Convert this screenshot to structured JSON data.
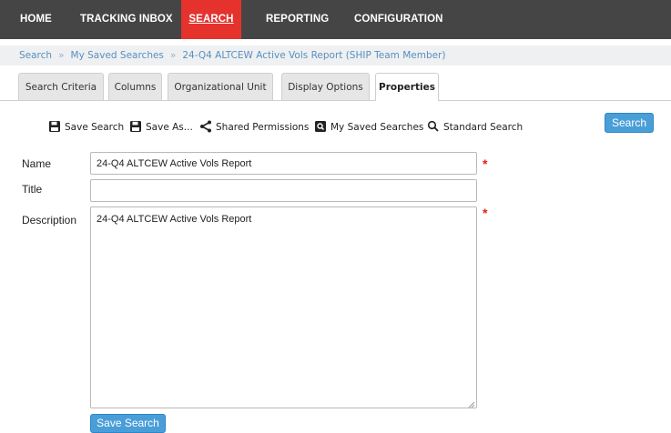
{
  "nav": {
    "items": [
      {
        "label": "HOME"
      },
      {
        "label": "TRACKING INBOX"
      },
      {
        "label": "SEARCH"
      },
      {
        "label": "REPORTING"
      },
      {
        "label": "CONFIGURATION"
      }
    ],
    "active": "SEARCH",
    "active_color": "#e5322d",
    "bg_color": "#454545"
  },
  "breadcrumb": [
    "Search",
    "My Saved Searches",
    "24-Q4 ALTCEW Active Vols Report (SHIP Team Member)"
  ],
  "tabs": [
    {
      "label": "Search Criteria"
    },
    {
      "label": "Columns"
    },
    {
      "label": "Organizational Unit"
    },
    {
      "label": "Display Options"
    },
    {
      "label": "Properties"
    }
  ],
  "active_tab": "Properties",
  "toolbar": {
    "save_search": {
      "label": "Save Search",
      "icon": "save-icon"
    },
    "save_as": {
      "label": "Save As...",
      "icon": "save-icon"
    },
    "shared_permissions": {
      "label": "Shared Permissions",
      "icon": "share-icon"
    },
    "my_saved_searches": {
      "label": "My Saved Searches",
      "icon": "saved-searches-icon"
    },
    "standard_search": {
      "label": "Standard Search",
      "icon": "search-icon"
    },
    "search_button": "Search"
  },
  "form": {
    "name_label": "Name",
    "name_value": "24-Q4 ALTCEW Active Vols Report",
    "title_label": "Title",
    "title_value": "",
    "description_label": "Description",
    "description_value": "24-Q4 ALTCEW Active Vols Report",
    "required_marker": "*",
    "save_button": "Save Search"
  },
  "accent_color": "#4a9ed8"
}
